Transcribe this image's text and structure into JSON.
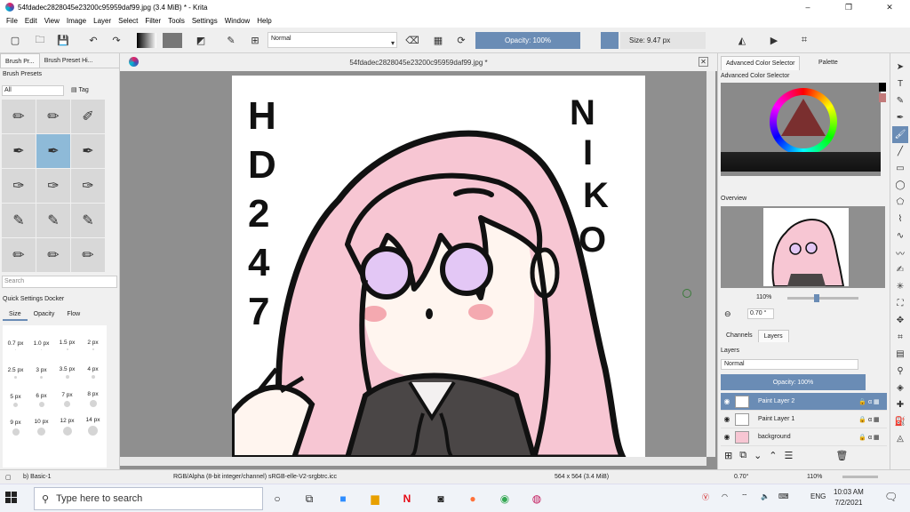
{
  "window": {
    "title": "54fdadec2828045e23200c95959daf99.jpg (3.4 MiB)  * - Krita",
    "minimize": "–",
    "maximize": "❐",
    "close": "✕"
  },
  "menu": [
    "File",
    "Edit",
    "View",
    "Image",
    "Layer",
    "Select",
    "Filter",
    "Tools",
    "Settings",
    "Window",
    "Help"
  ],
  "toolbar": {
    "blend_mode": "Normal",
    "opacity": "Opacity: 100%",
    "size": "Size: 9.47 px"
  },
  "left": {
    "tabs": [
      "Brush Pr...",
      "Brush Preset Hi..."
    ],
    "presets_label": "Brush Presets",
    "filter_all": "All",
    "tag_label": "Tag",
    "search_placeholder": "Search",
    "quick_settings": "Quick Settings Docker",
    "quick_tabs": [
      "Size",
      "Opacity",
      "Flow"
    ],
    "sizes": [
      "0.7 px",
      "1.0 px",
      "1.5 px",
      "2 px",
      "2.5 px",
      "3 px",
      "3.5 px",
      "4 px",
      "5 px",
      "6 px",
      "7 px",
      "8 px",
      "9 px",
      "10 px",
      "12 px",
      "14 px"
    ]
  },
  "canvas": {
    "tab_title": "54fdadec2828045e23200c95959daf99.jpg *",
    "text_left": [
      "H",
      "D",
      "2",
      "4",
      "7"
    ],
    "text_right": [
      "N",
      "I",
      "K",
      "O"
    ]
  },
  "right": {
    "tabs": [
      "Advanced Color Selector",
      "Palette"
    ],
    "color_selector_label": "Advanced Color Selector",
    "overview_label": "Overview",
    "zoom": "110%",
    "rotation": "0.70 °",
    "layer_tabs": [
      "Channels",
      "Layers"
    ],
    "layers_label": "Layers",
    "layer_blend": "Normal",
    "layer_opacity": "Opacity:  100%",
    "layers": [
      {
        "name": "Paint Layer 2",
        "selected": true
      },
      {
        "name": "Paint Layer 1",
        "selected": false
      },
      {
        "name": "background",
        "selected": false
      }
    ]
  },
  "status": {
    "brush": "b) Basic-1",
    "color_space": "RGB/Alpha (8-bit integer/channel)  sRGB-elle-V2-srgbtrc.icc",
    "dimensions": "564 x 564 (3.4 MiB)",
    "rotation": "0.70°",
    "zoom": "110%"
  },
  "taskbar": {
    "search_placeholder": "Type here to search",
    "language": "ENG",
    "time": "10:03 AM",
    "date": "7/2/2021"
  },
  "colors": {
    "accent": "#6a8cb5",
    "hair": "#f7c6d3",
    "eyes": "#e3c7f5",
    "blush": "#f4a9b0",
    "uniform": "#4a4646"
  }
}
